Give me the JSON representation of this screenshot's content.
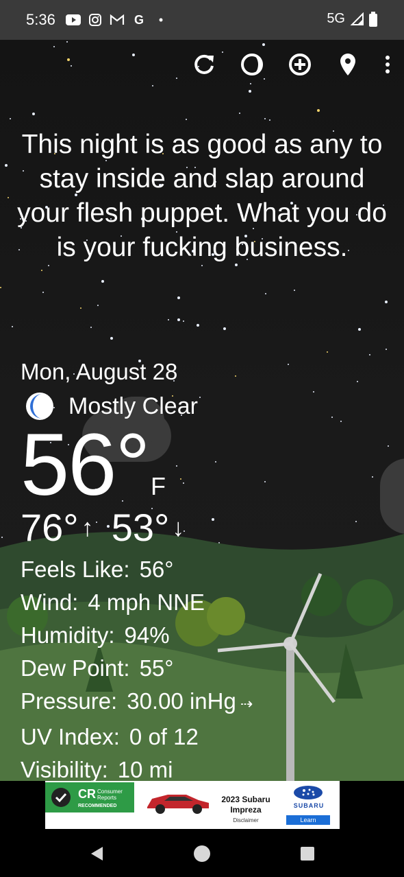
{
  "status_bar": {
    "time": "5:36",
    "network": "5G",
    "icons": [
      "youtube-icon",
      "instagram-icon",
      "gmail-icon",
      "google-icon",
      "dot-icon"
    ]
  },
  "toolbar": {
    "buttons": [
      "refresh-icon",
      "moon-phase-icon",
      "add-location-icon",
      "location-pin-icon",
      "more-vert-icon"
    ]
  },
  "headline": "This night is as good as any to stay inside and slap around your flesh puppet. What you do is your fucking business.",
  "forecast": {
    "date": "Mon, August 28",
    "condition": "Mostly Clear",
    "temperature": "56°",
    "unit": "F",
    "high": "76°",
    "low": "53°"
  },
  "details": {
    "feels_like": {
      "label": "Feels Like:",
      "value": "56°"
    },
    "wind": {
      "label": "Wind:",
      "value": "4 mph NNE"
    },
    "humidity": {
      "label": "Humidity:",
      "value": "94%"
    },
    "dew_point": {
      "label": "Dew Point:",
      "value": "55°"
    },
    "pressure": {
      "label": "Pressure:",
      "value": "30.00 inHg"
    },
    "uv_index": {
      "label": "UV Index:",
      "value": "0 of 12"
    },
    "visibility": {
      "label": "Visibility:",
      "value": "10 mi"
    }
  },
  "ad": {
    "badge_title": "CR",
    "badge_sub": "Consumer Reports",
    "badge_tag": "RECOMMENDED",
    "car_title": "2023 Subaru Impreza",
    "disclaimer": "Disclaimer",
    "brand": "SUBARU",
    "cta": "Learn"
  },
  "colors": {
    "accent_moon": "#2f6fd6",
    "ad_green": "#2e9b46",
    "ad_blue": "#1b6ed6"
  }
}
